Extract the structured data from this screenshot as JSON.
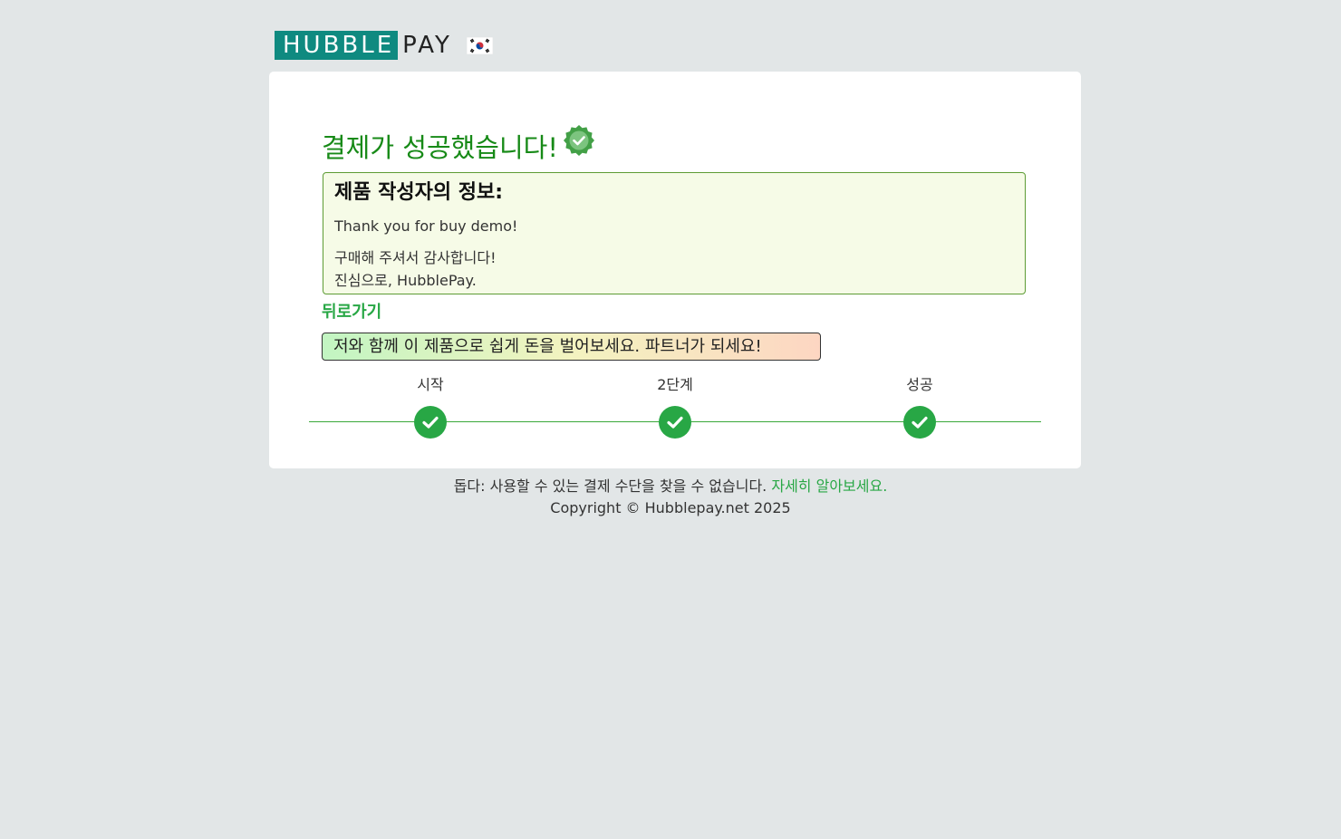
{
  "brand": {
    "logo_left": "HUBBLE",
    "logo_right": "PAY",
    "logo_color": "#0f8a80",
    "flag_icon": "korea-flag-icon"
  },
  "main": {
    "title": "결제가 성공했습니다!",
    "title_color": "#178a17",
    "title_icon": "verified-badge-icon",
    "info": {
      "heading": "제품 작성자의 정보:",
      "line1": "Thank you for buy demo!",
      "line2": "구매해 주셔서 감사합니다!",
      "line3": "진심으로, HubblePay."
    },
    "back_link": "뒤로가기",
    "promo": "저와 함께 이 제품으로 쉽게 돈을 벌어보세요. 파트너가 되세요!",
    "accent_color": "#28a745"
  },
  "steps": [
    {
      "label": "시작",
      "status": "complete",
      "icon": "check-circle-icon"
    },
    {
      "label": "2단계",
      "status": "complete",
      "icon": "check-circle-icon"
    },
    {
      "label": "성공",
      "status": "complete",
      "icon": "check-circle-icon"
    }
  ],
  "footer": {
    "help_text": "돕다: 사용할 수 있는 결제 수단을 찾을 수 없습니다.",
    "help_link": "자세히 알아보세요.",
    "copyright": "Copyright © Hubblepay.net 2025"
  }
}
